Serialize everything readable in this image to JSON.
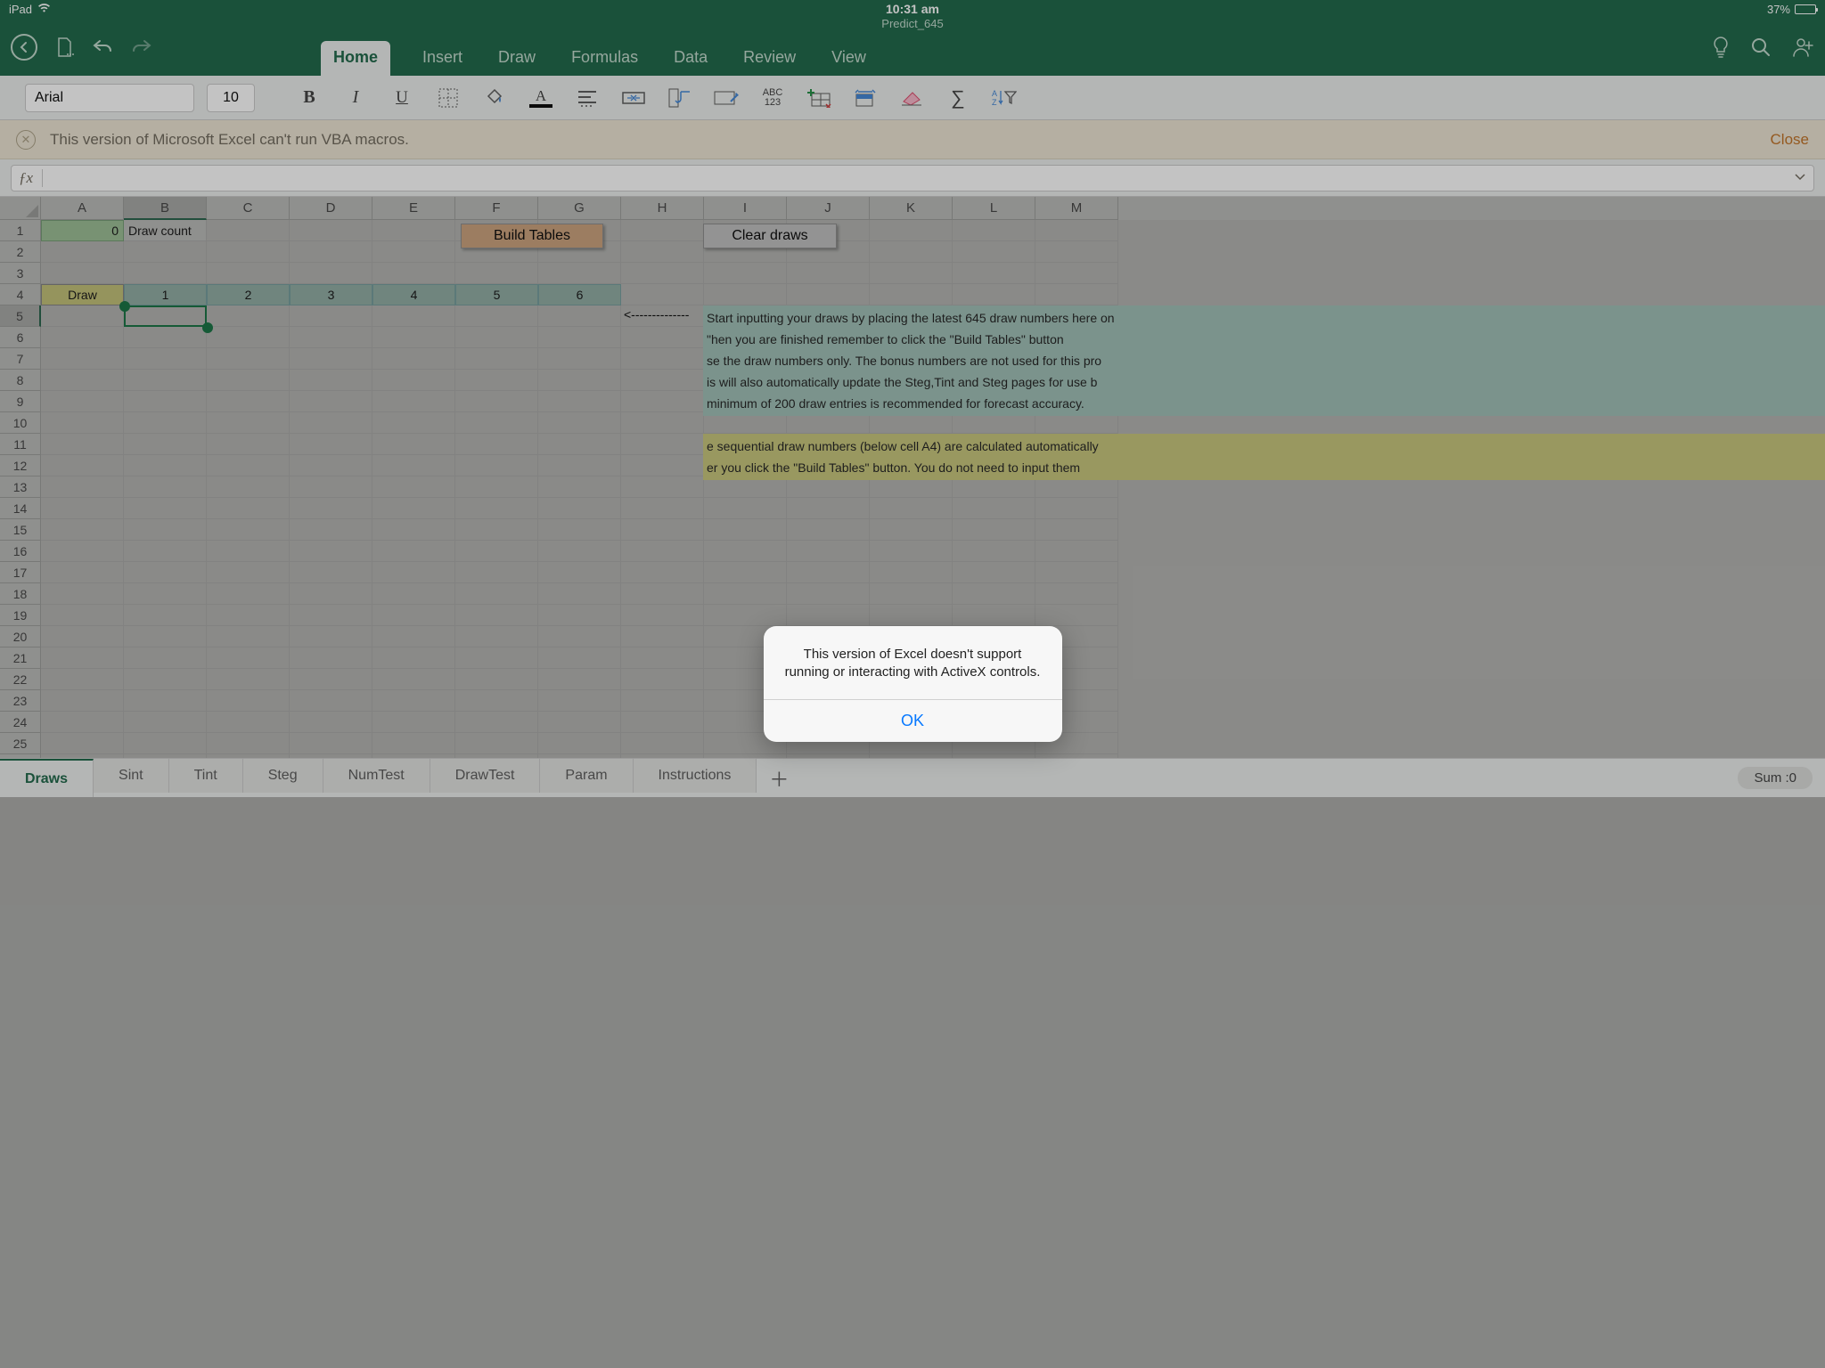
{
  "status": {
    "device": "iPad",
    "time": "10:31 am",
    "battery_pct": "37%"
  },
  "file_name": "Predict_645",
  "ribbon_tabs": [
    "Home",
    "Insert",
    "Draw",
    "Formulas",
    "Data",
    "Review",
    "View"
  ],
  "active_ribbon": 0,
  "font": {
    "name": "Arial",
    "size": "10"
  },
  "warning": {
    "msg": "This version of Microsoft Excel can't run VBA macros.",
    "close": "Close"
  },
  "columns": [
    "A",
    "B",
    "C",
    "D",
    "E",
    "F",
    "G",
    "H",
    "I",
    "J",
    "K",
    "L",
    "M"
  ],
  "row_count": 27,
  "cells": {
    "A1": "0",
    "B1": "Draw count",
    "A4": "Draw",
    "B4": "1",
    "C4": "2",
    "D4": "3",
    "E4": "4",
    "F4": "5",
    "G4": "6"
  },
  "buttons": {
    "build": "Build Tables",
    "clear": "Clear draws"
  },
  "notes": {
    "arrow": "<--------------",
    "teal": [
      "Start inputting your draws by placing the latest 645 draw numbers here on",
      "\"hen you are finished remember to click the \"Build Tables\" button",
      "se the draw numbers only. The bonus numbers are not used for this pro",
      "is will also automatically update the Steg,Tint and Steg pages for use b",
      "minimum of 200 draw entries is recommended for forecast accuracy."
    ],
    "olive": [
      "e sequential draw numbers (below cell A4) are calculated automatically",
      "er you click the \"Build Tables\" button. You do not need to input them"
    ]
  },
  "sheets": [
    "Draws",
    "Sint",
    "Tint",
    "Steg",
    "NumTest",
    "DrawTest",
    "Param",
    "Instructions"
  ],
  "active_sheet": 0,
  "sum_label": "Sum :0",
  "modal": {
    "body": "This version of Excel doesn't support running or interacting with ActiveX controls.",
    "ok": "OK"
  },
  "abc123": "ABC\n123"
}
